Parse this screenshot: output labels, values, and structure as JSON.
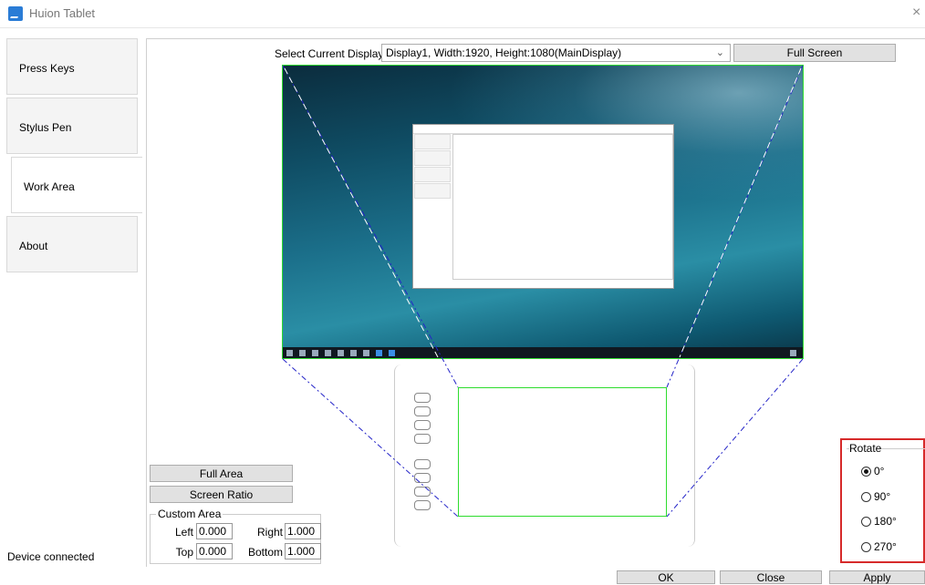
{
  "window": {
    "title": "Huion Tablet"
  },
  "sidebar": {
    "items": [
      {
        "label": "Press Keys"
      },
      {
        "label": "Stylus Pen"
      },
      {
        "label": "Work Area"
      },
      {
        "label": "About"
      }
    ],
    "active": "Work Area"
  },
  "display": {
    "label": "Select Current Display",
    "selected": "Display1, Width:1920, Height:1080(MainDisplay)",
    "full_screen_label": "Full Screen"
  },
  "area": {
    "full_area_label": "Full Area",
    "screen_ratio_label": "Screen Ratio"
  },
  "custom_area": {
    "title": "Custom Area",
    "left_label": "Left",
    "left_value": "0.000",
    "right_label": "Right",
    "right_value": "1.000",
    "top_label": "Top",
    "top_value": "0.000",
    "bottom_label": "Bottom",
    "bottom_value": "1.000"
  },
  "rotate": {
    "title": "Rotate",
    "options": [
      "0°",
      "90°",
      "180°",
      "270°"
    ],
    "selected": "0°"
  },
  "status": {
    "text": "Device connected"
  },
  "footer": {
    "ok": "OK",
    "close": "Close",
    "apply": "Apply"
  },
  "colors": {
    "accent_green": "#2edc2e",
    "highlight_red": "#d62a2a",
    "guide_blue": "#2424c8"
  }
}
